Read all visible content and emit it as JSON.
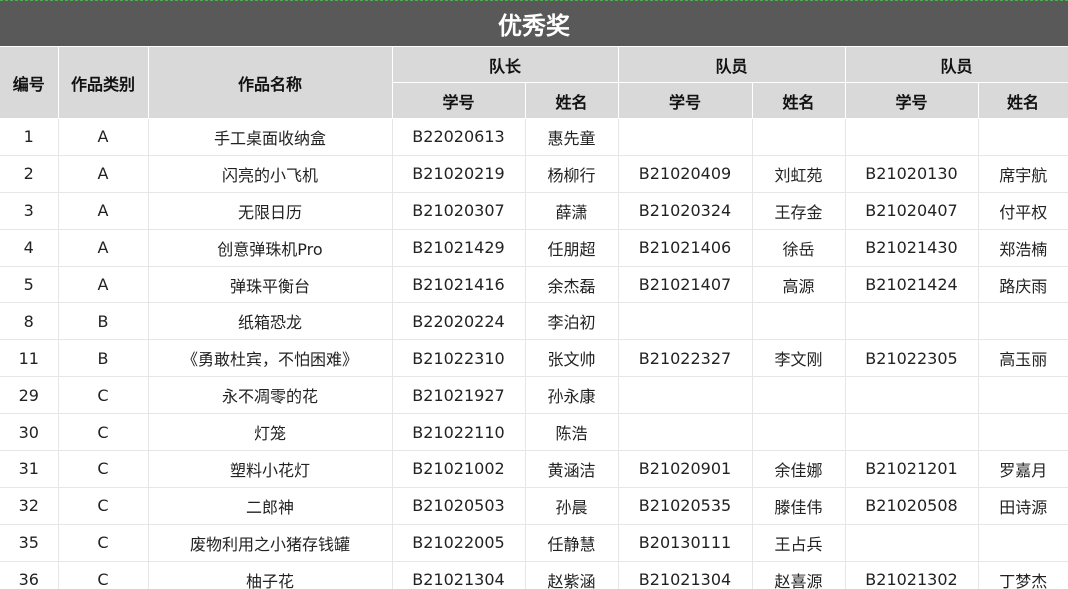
{
  "title": "优秀奖",
  "headers": {
    "no": "编号",
    "category": "作品类别",
    "work_name": "作品名称",
    "captain": "队长",
    "member": "队员",
    "student_id": "学号",
    "name": "姓名"
  },
  "rows": [
    [
      "1",
      "A",
      "手工桌面收纳盒",
      "B22020613",
      "惠先童",
      "",
      "",
      "",
      ""
    ],
    [
      "2",
      "A",
      "闪亮的小飞机",
      "B21020219",
      "杨柳行",
      "B21020409",
      "刘虹苑",
      "B21020130",
      "席宇航"
    ],
    [
      "3",
      "A",
      "无限日历",
      "B21020307",
      "薛潇",
      "B21020324",
      "王存金",
      "B21020407",
      "付平权"
    ],
    [
      "4",
      "A",
      "创意弹珠机Pro",
      "B21021429",
      "任朋超",
      "B21021406",
      "徐岳",
      "B21021430",
      "郑浩楠"
    ],
    [
      "5",
      "A",
      "弹珠平衡台",
      "B21021416",
      "余杰磊",
      "B21021407",
      "高源",
      "B21021424",
      "路庆雨"
    ],
    [
      "8",
      "B",
      "纸箱恐龙",
      "B22020224",
      "李泊初",
      "",
      "",
      "",
      ""
    ],
    [
      "11",
      "B",
      "《勇敢杜宾，不怕困难》",
      "B21022310",
      "张文帅",
      "B21022327",
      "李文刚",
      "B21022305",
      "高玉丽"
    ],
    [
      "29",
      "C",
      "永不凋零的花",
      "B21021927",
      "孙永康",
      "",
      "",
      "",
      ""
    ],
    [
      "30",
      "C",
      "灯笼",
      "B21022110",
      "陈浩",
      "",
      "",
      "",
      ""
    ],
    [
      "31",
      "C",
      "塑料小花灯",
      "B21021002",
      "黄涵洁",
      "B21020901",
      "余佳娜",
      "B21021201",
      "罗嘉月"
    ],
    [
      "32",
      "C",
      "二郎神",
      "B21020503",
      "孙晨",
      "B21020535",
      "滕佳伟",
      "B21020508",
      "田诗源"
    ],
    [
      "35",
      "C",
      "废物利用之小猪存钱罐",
      "B21022005",
      "任静慧",
      "B20130111",
      "王占兵",
      "",
      ""
    ],
    [
      "36",
      "C",
      "柚子花",
      "B21021304",
      "赵紫涵",
      "B21021304",
      "赵喜源",
      "B21021302",
      "丁梦杰"
    ]
  ]
}
